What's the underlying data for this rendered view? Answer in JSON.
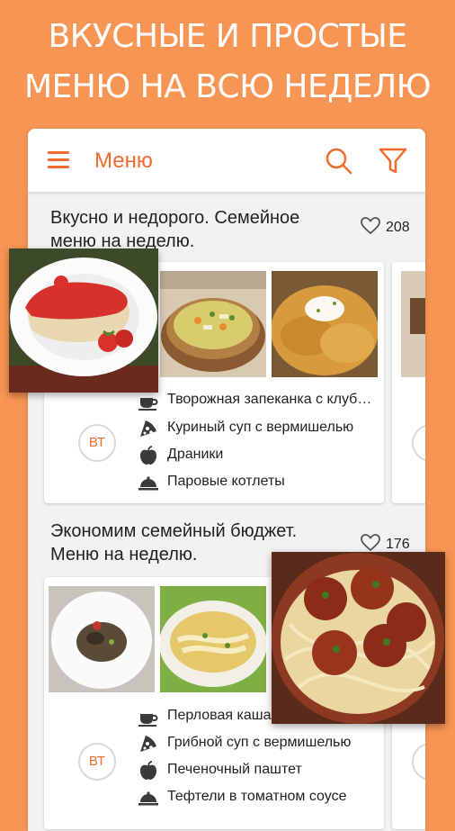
{
  "promo": {
    "line1": "ВКУСНЫЕ И ПРОСТЫЕ",
    "line2": "МЕНЮ НА ВСЮ НЕДЕЛЮ"
  },
  "appbar": {
    "title": "Меню"
  },
  "menus": [
    {
      "title": "Вкусно и недорого. Семейное меню на неделю.",
      "likes": "208",
      "day_badge": "ВТ",
      "meals": [
        {
          "icon": "coffee-cup-icon",
          "name": "Творожная запеканка с клуб…"
        },
        {
          "icon": "pizza-slice-icon",
          "name": "Куриный суп с вермишелью"
        },
        {
          "icon": "apple-icon",
          "name": "Драники"
        },
        {
          "icon": "cloche-icon",
          "name": "Паровые котлеты"
        }
      ]
    },
    {
      "title": "Экономим семейный бюджет. Меню на неделю.",
      "likes": "176",
      "day_badge": "ВТ",
      "meals": [
        {
          "icon": "coffee-cup-icon",
          "name": "Перловая каша"
        },
        {
          "icon": "pizza-slice-icon",
          "name": "Грибной суп с вермишелью"
        },
        {
          "icon": "apple-icon",
          "name": "Печеночный паштет"
        },
        {
          "icon": "cloche-icon",
          "name": "Тефтели в томатном соусе"
        }
      ]
    }
  ],
  "colors": {
    "background": "#f79554",
    "accent": "#f06b2d"
  }
}
